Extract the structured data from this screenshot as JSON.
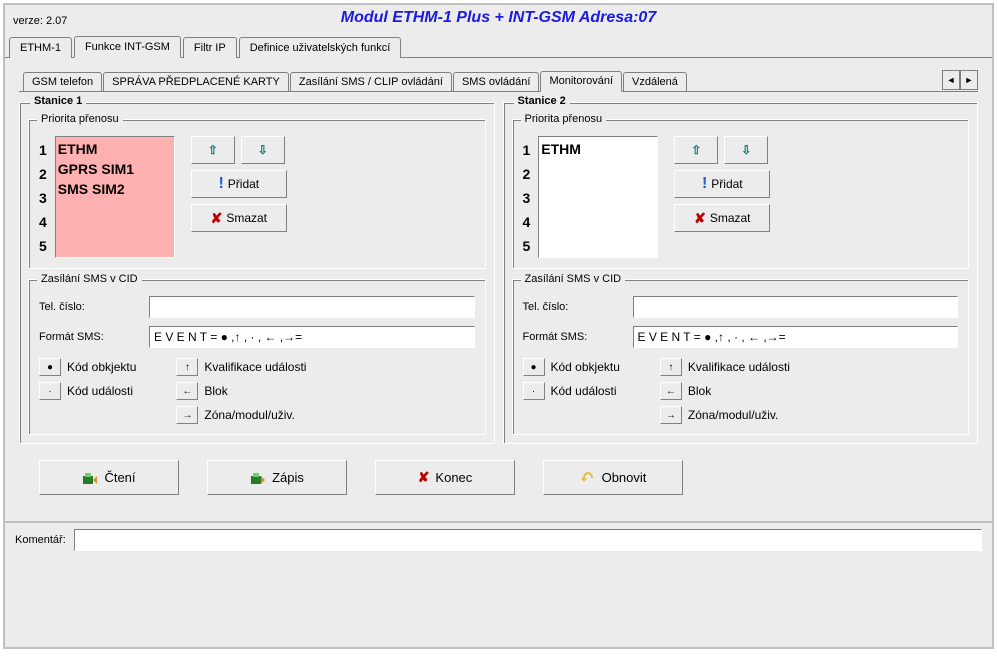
{
  "title": "Modul ETHM-1 Plus + INT-GSM Adresa:07",
  "version_label": "verze: 2.07",
  "main_tabs": [
    "ETHM-1",
    "Funkce INT-GSM",
    "Filtr IP",
    "Definice uživatelských funkcí"
  ],
  "main_tab_active": 1,
  "inner_tabs": [
    "GSM telefon",
    "SPRÁVA PŘEDPLACENÉ KARTY",
    "Zasílání SMS / CLIP ovládání",
    "SMS ovládání",
    "Monitorování",
    "Vzdálená"
  ],
  "inner_tab_active": 4,
  "station1": {
    "title": "Stanice 1",
    "priority_label": "Priorita přenosu",
    "numbers": [
      "1",
      "2",
      "3",
      "4",
      "5"
    ],
    "items": [
      "ETHM",
      "GPRS SIM1",
      "SMS SIM2"
    ],
    "pink": true,
    "btn_add": "Přidat",
    "btn_del": "Smazat",
    "sms_fieldset": "Zasílání SMS v CID",
    "tel_label": "Tel. číslo:",
    "tel_value": "",
    "format_label": "Formát SMS:",
    "format_value": "E V E N T = ● ,↑ , · , ← ,→=",
    "leg_obj": "Kód obkjektu",
    "leg_evt": "Kód události",
    "leg_qual": "Kvalifikace události",
    "leg_blok": "Blok",
    "leg_zone": "Zóna/modul/uživ."
  },
  "station2": {
    "title": "Stanice 2",
    "priority_label": "Priorita přenosu",
    "numbers": [
      "1",
      "2",
      "3",
      "4",
      "5"
    ],
    "items": [
      "ETHM"
    ],
    "pink": false,
    "btn_add": "Přidat",
    "btn_del": "Smazat",
    "sms_fieldset": "Zasílání SMS v CID",
    "tel_label": "Tel. číslo:",
    "tel_value": "",
    "format_label": "Formát SMS:",
    "format_value": "E V E N T = ● ,↑ , · , ← ,→=",
    "leg_obj": "Kód obkjektu",
    "leg_evt": "Kód události",
    "leg_qual": "Kvalifikace události",
    "leg_blok": "Blok",
    "leg_zone": "Zóna/modul/uživ."
  },
  "buttons": {
    "read": "Čtení",
    "write": "Zápis",
    "close": "Konec",
    "refresh": "Obnovit"
  },
  "comment_label": "Komentář:"
}
